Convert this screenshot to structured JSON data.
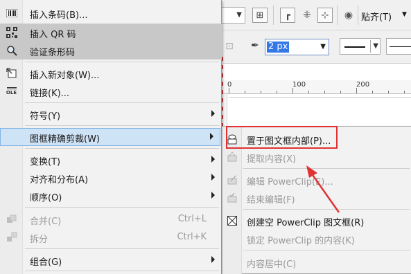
{
  "menu": {
    "items": [
      {
        "label": "插入条码(B)...",
        "icon": "barcode-icon"
      },
      {
        "label": "插入 QR 码",
        "icon": "qr-code-icon"
      },
      {
        "label": "验证条形码",
        "icon": "magnifier-icon"
      },
      {
        "label": "插入新对象(W)...",
        "icon": "insert-object-icon"
      },
      {
        "label": "链接(K)...",
        "icon": "ole-link-icon",
        "icon_text": "OLE"
      },
      {
        "label": "符号(Y)"
      },
      {
        "label": "图框精确剪裁(W)"
      },
      {
        "label": "变换(T)"
      },
      {
        "label": "对齐和分布(A)"
      },
      {
        "label": "顺序(O)"
      },
      {
        "label": "合并(C)",
        "shortcut": "Ctrl+L",
        "icon": "combine-icon"
      },
      {
        "label": "拆分",
        "shortcut": "Ctrl+K",
        "icon": "break-apart-icon"
      },
      {
        "label": "组合(G)"
      }
    ]
  },
  "submenu": {
    "items": [
      {
        "label": "置于图文框内部(P)...",
        "icon": "place-inside-frame-icon"
      },
      {
        "label": "提取内容(X)",
        "icon": "extract-contents-icon"
      },
      {
        "label": "编辑 PowerClip(E)...",
        "icon": "edit-powerclip-icon"
      },
      {
        "label": "结束编辑(F)",
        "icon": "finish-editing-icon"
      },
      {
        "label": "创建空 PowerClip 图文框(R)",
        "icon": "empty-frame-icon"
      },
      {
        "label": "锁定 PowerClip 的内容(K)"
      },
      {
        "label": "内容居中(C)"
      }
    ]
  },
  "toolbar": {
    "align_label": "贴齐(T)",
    "outline_width": "2 px"
  },
  "ruler": {
    "labels": [
      "0",
      "100",
      "200"
    ]
  },
  "colors": {
    "highlight_gray": "#c8c8c8",
    "submenu_open": "#cfe3f7",
    "annotation_red": "#e03232",
    "selection_blue": "#3478e8"
  }
}
